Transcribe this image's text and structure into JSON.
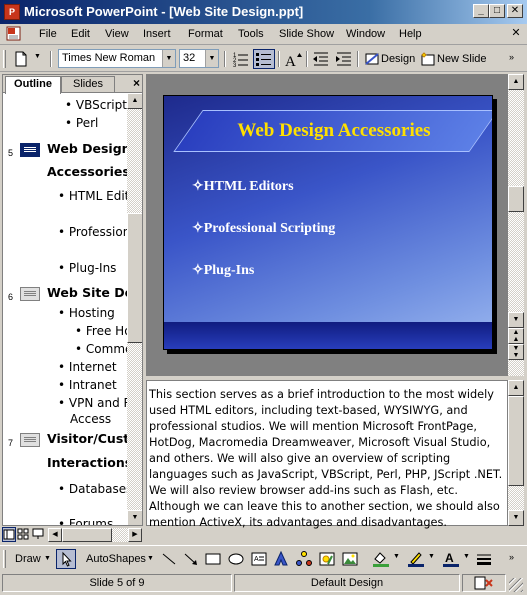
{
  "window": {
    "title": "Microsoft PowerPoint - [Web Site Design.ppt]",
    "app_icon": "P",
    "minimize": "_",
    "maximize": "□",
    "close": "✕"
  },
  "menu": {
    "items": [
      "File",
      "Edit",
      "View",
      "Insert",
      "Format",
      "Tools",
      "Slide Show",
      "Window",
      "Help"
    ],
    "doc_close": "✕"
  },
  "toolbar": {
    "font_name": "Times New Roman",
    "font_size": "32",
    "design_label": "Design",
    "new_slide_label": "New Slide"
  },
  "outline_tabs": {
    "outline": "Outline",
    "slides": "Slides",
    "close": "×"
  },
  "outline": {
    "items": [
      {
        "level": "b2",
        "text": "VBScript"
      },
      {
        "level": "b2",
        "text": "Perl"
      },
      {
        "level": "title",
        "num": "5",
        "text": "Web Design",
        "selected": true
      },
      {
        "level": "title-cont",
        "text": "Accessories"
      },
      {
        "level": "b1",
        "text": "HTML Editors"
      },
      {
        "level": "b1",
        "text": "Professional Scripting"
      },
      {
        "level": "b1",
        "text": "Plug-Ins"
      },
      {
        "level": "title",
        "num": "6",
        "text": "Web Site Design"
      },
      {
        "level": "b1",
        "text": "Hosting"
      },
      {
        "level": "b2",
        "text": "Free Hosting"
      },
      {
        "level": "b2",
        "text": "Commercial"
      },
      {
        "level": "b1",
        "text": "Internet"
      },
      {
        "level": "b1",
        "text": "Intranet"
      },
      {
        "level": "b1",
        "text": "VPN and Remote"
      },
      {
        "level": "b1-cont",
        "text": "Access"
      },
      {
        "level": "title",
        "num": "7",
        "text": "Visitor/Customer"
      },
      {
        "level": "title-cont",
        "text": "Interactions"
      },
      {
        "level": "b1",
        "text": "Databases"
      },
      {
        "level": "b1",
        "text": "Forums"
      }
    ]
  },
  "slide": {
    "title": "Web Design Accessories",
    "bullets": [
      "✧HTML Editors",
      "✧Professional Scripting",
      "✧Plug-Ins"
    ]
  },
  "notes": {
    "text": "This section serves as a brief introduction to the most widely used HTML editors, including text-based, WYSIWYG, and professional studios. We will mention Microsoft FrontPage, HotDog, Macromedia Dreamweaver, Microsoft Visual Studio, and others. We will also give an overview of scripting languages such as JavaScript, VBScript, Perl, PHP, JScript .NET. We will also review browser add-ins such as Flash, etc. Although we can leave this to another section, we should also mention ActiveX, its advantages and disadvantages."
  },
  "drawing": {
    "draw_label": "Draw",
    "autoshapes_label": "AutoShapes"
  },
  "status": {
    "slide": "Slide 5 of 9",
    "design": "Default Design"
  },
  "colors": {
    "titlebar": "#0a246a",
    "slide_title": "#ffe000",
    "slide_bg": "#3a55c8"
  }
}
